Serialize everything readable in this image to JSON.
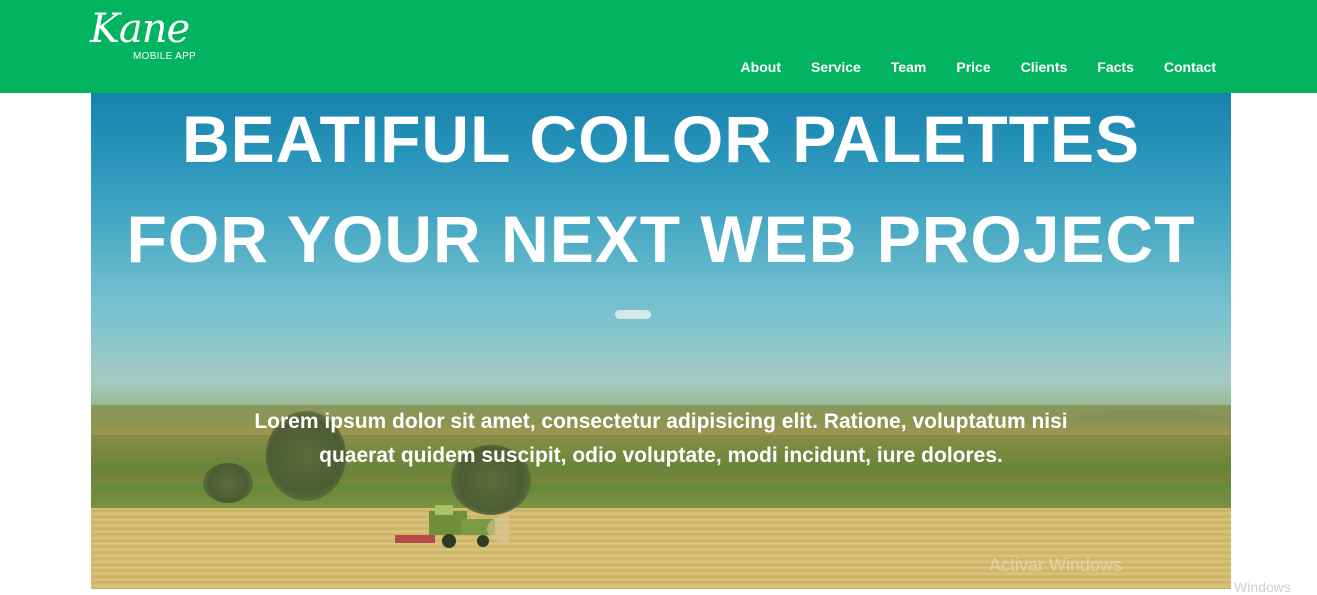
{
  "brand": {
    "name": "Kane",
    "tagline": "MOBILE APP"
  },
  "nav": {
    "items": [
      {
        "label": "About"
      },
      {
        "label": "Service"
      },
      {
        "label": "Team"
      },
      {
        "label": "Price"
      },
      {
        "label": "Clients"
      },
      {
        "label": "Facts"
      },
      {
        "label": "Contact"
      }
    ]
  },
  "hero": {
    "title_line1": "BEATIFUL COLOR PALETTES",
    "title_line2": "FOR YOUR NEXT WEB PROJECT",
    "text": "Lorem ipsum dolor sit amet, consectetur adipisicing elit. Ratione, voluptatum nisi quaerat quidem suscipit, odio voluptate, modi incidunt, iure dolores."
  },
  "watermark": {
    "text": "Activar Windows",
    "text2": "Windows"
  },
  "colors": {
    "navbar": "#02b35f",
    "text": "#ffffff"
  }
}
